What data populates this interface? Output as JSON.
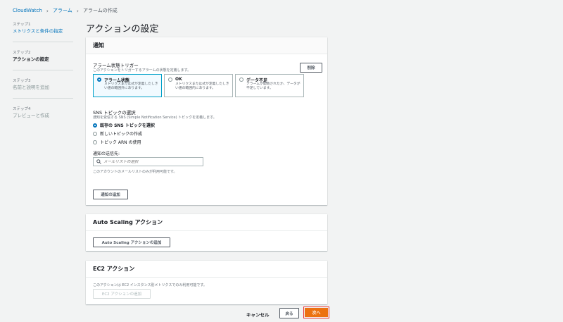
{
  "breadcrumb": {
    "items": [
      "CloudWatch",
      "アラーム",
      "アラームの作成"
    ]
  },
  "steps": [
    {
      "num": "ステップ1",
      "title": "メトリクスと条件の指定",
      "state": "link"
    },
    {
      "num": "ステップ2",
      "title": "アクションの設定",
      "state": "active"
    },
    {
      "num": "ステップ3",
      "title": "名前と説明を追加",
      "state": "disabled"
    },
    {
      "num": "ステップ4",
      "title": "プレビューと作成",
      "state": "disabled"
    }
  ],
  "page_title": "アクションの設定",
  "notification": {
    "header": "通知",
    "trigger_label": "アラーム状態トリガー",
    "trigger_desc": "このアクションをトリガーするアラームの状態を定義します。",
    "remove_label": "削除",
    "tiles": [
      {
        "title": "アラーム状態",
        "desc": "メトリクスまたは式が定義したしきい値の範囲外にあります。",
        "selected": true
      },
      {
        "title": "OK",
        "desc": "メトリクスまたは式が定義したしきい値の範囲内にあります。",
        "selected": false
      },
      {
        "title": "データ不足",
        "desc": "アラームが開始されたか、データが不足しています。",
        "selected": false
      }
    ],
    "sns_label": "SNS トピックの選択",
    "sns_desc": "通知を受信する SNS (Simple Notification Service) トピックを定義します。",
    "sns_options": [
      {
        "label": "既存の SNS トピックを選択",
        "checked": true
      },
      {
        "label": "新しいトピックの作成",
        "checked": false
      },
      {
        "label": "トピック ARN の使用",
        "checked": false
      }
    ],
    "send_to_label": "通知の送信先:",
    "search_placeholder": "メールリストの選択",
    "send_to_desc": "このアカウントのメールリストのみが利用可能です。",
    "add_notification_label": "通知の追加"
  },
  "autoscaling": {
    "header": "Auto Scaling アクション",
    "add_label": "Auto Scaling アクションの追加"
  },
  "ec2": {
    "header": "EC2 アクション",
    "desc": "このアクションは EC2 インスタンス別メトリクスでのみ利用可能です。",
    "add_label": "EC2 アクションの追加"
  },
  "footer": {
    "cancel_label": "キャンセル",
    "back_label": "戻る",
    "next_label": "次へ"
  },
  "colors": {
    "primary": "#ec7211",
    "link": "#0073bb",
    "highlight": "#e8393a"
  }
}
